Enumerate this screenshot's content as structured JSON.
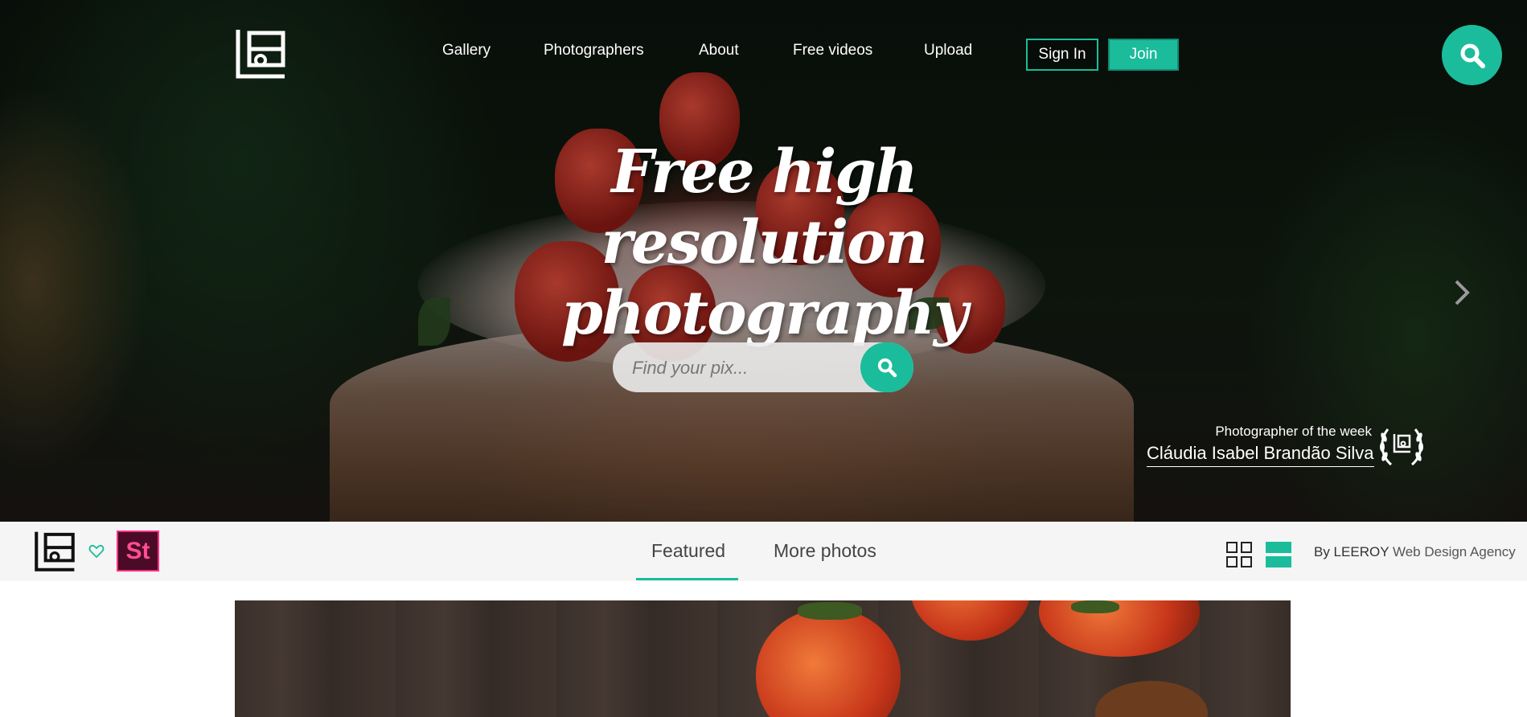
{
  "nav": {
    "logo_icon": "lpx-logo-icon",
    "links": [
      "Gallery",
      "Photographers",
      "About",
      "Free videos",
      "Upload"
    ],
    "sign_in": "Sign In",
    "join": "Join",
    "search_icon": "search-icon"
  },
  "hero": {
    "title_line1": "Free high resolution",
    "title_line2": "photography",
    "search_placeholder": "Find your pix...",
    "next_icon": "chevron-right-icon",
    "photographer_label": "Photographer of the week",
    "photographer_name": "Cláudia Isabel Brandão Silva",
    "award_icon": "laurel-icon"
  },
  "subbar": {
    "heart_icon": "heart-icon",
    "stock_badge": "St",
    "tabs": [
      "Featured",
      "More photos"
    ],
    "active_tab": "Featured",
    "grid_icon": "grid-view-icon",
    "list_icon": "list-view-icon",
    "credit_by": "By LEEROY",
    "credit_agency": "Web Design Agency"
  },
  "colors": {
    "accent": "#1bbc9b",
    "stock_pink": "#ff2e80",
    "subbar_bg": "#f5f5f5"
  }
}
